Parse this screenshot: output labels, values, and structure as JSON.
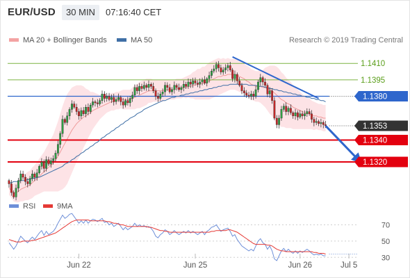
{
  "header": {
    "symbol": "EUR/USD",
    "timeframe": "30 MIN",
    "time": "07:16:40 CET"
  },
  "credit": "Research © 2019 Trading Central",
  "colors": {
    "up": "#2f9e44",
    "down": "#c62828",
    "bb_fill": "#fde3e6",
    "ma20": "#ef9a9a",
    "ma50": "#3f6fa6",
    "support": "#e3000f",
    "resistance": "#7cb342",
    "pivot": "#2e66cc",
    "price_tag": "#333333",
    "rsi": "#6e8fd8",
    "rsi_ma": "#e53935"
  },
  "chart_data": [
    {
      "type": "candlestick",
      "title": "EUR/USD 30 MIN",
      "legend": [
        {
          "name": "MA 20 + Bollinger Bands",
          "color": "#ef9a9a"
        },
        {
          "name": "MA 50",
          "color": "#3f6fa6"
        }
      ],
      "legend_position": "top",
      "x_ticks": [
        "Jun 22",
        "Jun 25",
        "Jun 26",
        "Jul 5"
      ],
      "ylim": [
        1.128,
        1.144
      ],
      "levels": [
        {
          "label": "1.1410",
          "value": 1.141,
          "kind": "resistance"
        },
        {
          "label": "1.1395",
          "value": 1.1395,
          "kind": "resistance"
        },
        {
          "label": "1.1380",
          "value": 1.138,
          "kind": "pivot"
        },
        {
          "label": "1.1353",
          "value": 1.1353,
          "kind": "last_price"
        },
        {
          "label": "1.1340",
          "value": 1.134,
          "kind": "support"
        },
        {
          "label": "1.1320",
          "value": 1.132,
          "kind": "support"
        }
      ],
      "close": [
        1.13,
        1.1292,
        1.1288,
        1.1296,
        1.1303,
        1.1309,
        1.1306,
        1.1302,
        1.13,
        1.1305,
        1.1309,
        1.1306,
        1.131,
        1.1316,
        1.132,
        1.1314,
        1.1322,
        1.1318,
        1.1321,
        1.1323,
        1.1328,
        1.1336,
        1.1346,
        1.1359,
        1.1356,
        1.1362,
        1.1368,
        1.1373,
        1.137,
        1.1366,
        1.1362,
        1.1367,
        1.1364,
        1.137,
        1.1366,
        1.1372,
        1.1375,
        1.1374,
        1.1373,
        1.1376,
        1.1382,
        1.1378,
        1.138,
        1.1377,
        1.1379,
        1.1375,
        1.1377,
        1.1379,
        1.1375,
        1.1372,
        1.1376,
        1.1374,
        1.1378,
        1.1381,
        1.1388,
        1.1385,
        1.1389,
        1.1387,
        1.139,
        1.1388,
        1.1391,
        1.1389,
        1.1385,
        1.138,
        1.1378,
        1.1382,
        1.1384,
        1.139,
        1.1388,
        1.1384,
        1.1386,
        1.139,
        1.1388,
        1.1386,
        1.1388,
        1.1391,
        1.1389,
        1.1393,
        1.1391,
        1.1394,
        1.1392,
        1.1391,
        1.1393,
        1.1395,
        1.1392,
        1.1396,
        1.1399,
        1.1403,
        1.1405,
        1.1409,
        1.1406,
        1.1402,
        1.1404,
        1.1406,
        1.1408,
        1.1404,
        1.1396,
        1.14,
        1.1394,
        1.139,
        1.1385,
        1.1383,
        1.1381,
        1.138,
        1.1382,
        1.138,
        1.1386,
        1.1393,
        1.1397,
        1.1393,
        1.139,
        1.1382,
        1.1385,
        1.1376,
        1.136,
        1.1354,
        1.136,
        1.1368,
        1.1371,
        1.1366,
        1.1369,
        1.1365,
        1.1362,
        1.1365,
        1.1361,
        1.1364,
        1.1362,
        1.1364,
        1.1366,
        1.1364,
        1.1359,
        1.1356,
        1.1357,
        1.1355,
        1.1356,
        1.1354,
        1.1353
      ],
      "ma20": [
        1.1296,
        1.1294,
        1.1292,
        1.1292,
        1.1293,
        1.1295,
        1.1296,
        1.1297,
        1.1298,
        1.1299,
        1.1301,
        1.1303,
        1.1305,
        1.1307,
        1.1309,
        1.1311,
        1.1313,
        1.1315,
        1.1317,
        1.1319,
        1.1322,
        1.1325,
        1.1329,
        1.1333,
        1.1337,
        1.1341,
        1.1345,
        1.1349,
        1.1352,
        1.1355,
        1.1357,
        1.1359,
        1.1361,
        1.1362,
        1.1364,
        1.1365,
        1.1367,
        1.1368,
        1.1369,
        1.137,
        1.1371,
        1.1372,
        1.1373,
        1.1374,
        1.1375,
        1.1375,
        1.1376,
        1.1376,
        1.1377,
        1.1377,
        1.1377,
        1.1377,
        1.1377,
        1.1378,
        1.1379,
        1.138,
        1.1381,
        1.1382,
        1.1383,
        1.1384,
        1.1385,
        1.1385,
        1.1385,
        1.1385,
        1.1385,
        1.1385,
        1.1385,
        1.1386,
        1.1386,
        1.1386,
        1.1386,
        1.1386,
        1.1387,
        1.1387,
        1.1387,
        1.1388,
        1.1388,
        1.1389,
        1.1389,
        1.139,
        1.139,
        1.1391,
        1.1391,
        1.1392,
        1.1392,
        1.1393,
        1.1394,
        1.1395,
        1.1396,
        1.1397,
        1.1398,
        1.1398,
        1.1399,
        1.1399,
        1.14,
        1.14,
        1.14,
        1.14,
        1.1399,
        1.1398,
        1.1397,
        1.1396,
        1.1394,
        1.1393,
        1.1391,
        1.139,
        1.1389,
        1.1389,
        1.1389,
        1.1388,
        1.1388,
        1.1387,
        1.1386,
        1.1385,
        1.1383,
        1.1381,
        1.1379,
        1.1377,
        1.1376,
        1.1374,
        1.1373,
        1.1372,
        1.137,
        1.1369,
        1.1368,
        1.1367,
        1.1366,
        1.1365,
        1.1364,
        1.1364,
        1.1363,
        1.1362,
        1.1362,
        1.1361,
        1.1361,
        1.136,
        1.136
      ],
      "bb_width": [
        0.0006,
        0.0007,
        0.0008,
        0.0009,
        0.001,
        0.0011,
        0.0012,
        0.0012,
        0.0013,
        0.0013,
        0.0014,
        0.0014,
        0.0015,
        0.0016,
        0.0017,
        0.0018,
        0.002,
        0.0022,
        0.0024,
        0.0026,
        0.0029,
        0.0032,
        0.0035,
        0.0038,
        0.004,
        0.0041,
        0.004,
        0.0039,
        0.0037,
        0.0035,
        0.0033,
        0.0031,
        0.0028,
        0.0025,
        0.0022,
        0.0019,
        0.0017,
        0.0015,
        0.0013,
        0.0011,
        0.001,
        0.0009,
        0.0008,
        0.0008,
        0.0008,
        0.0008,
        0.0008,
        0.0008,
        0.0008,
        0.0009,
        0.0009,
        0.0009,
        0.0009,
        0.001,
        0.0011,
        0.0011,
        0.0012,
        0.0012,
        0.0012,
        0.0012,
        0.0011,
        0.0011,
        0.001,
        0.001,
        0.001,
        0.001,
        0.001,
        0.0009,
        0.0009,
        0.0009,
        0.0009,
        0.0009,
        0.0009,
        0.0009,
        0.0009,
        0.0009,
        0.001,
        0.001,
        0.0011,
        0.0012,
        0.0013,
        0.0014,
        0.0014,
        0.0015,
        0.0015,
        0.0016,
        0.0017,
        0.0017,
        0.0017,
        0.0017,
        0.0017,
        0.0016,
        0.0016,
        0.0015,
        0.0015,
        0.0014,
        0.0014,
        0.0014,
        0.0014,
        0.0014,
        0.0014,
        0.0014,
        0.0014,
        0.0014,
        0.0014,
        0.0014,
        0.0014,
        0.0014,
        0.0015,
        0.0016,
        0.0018,
        0.002,
        0.0022,
        0.0023,
        0.0025,
        0.0026,
        0.0026,
        0.0025,
        0.0024,
        0.0023,
        0.0022,
        0.0021,
        0.002,
        0.0019,
        0.0018,
        0.0017,
        0.0016,
        0.0015,
        0.0014,
        0.0014,
        0.0013,
        0.0013,
        0.0012,
        0.0012,
        0.0012,
        0.0012,
        0.0012
      ],
      "ma50": [
        1.1301,
        1.1301,
        1.1302,
        1.1302,
        1.1302,
        1.1303,
        1.1303,
        1.1303,
        1.1304,
        1.1304,
        1.1305,
        1.1305,
        1.1306,
        1.1306,
        1.1307,
        1.1308,
        1.1309,
        1.131,
        1.1311,
        1.1312,
        1.1313,
        1.1314,
        1.1315,
        1.1316,
        1.1318,
        1.1319,
        1.132,
        1.1322,
        1.1323,
        1.1325,
        1.1326,
        1.1328,
        1.1329,
        1.1331,
        1.1332,
        1.1334,
        1.1335,
        1.1337,
        1.1338,
        1.134,
        1.1342,
        1.1343,
        1.1345,
        1.1346,
        1.1348,
        1.1349,
        1.1351,
        1.1352,
        1.1354,
        1.1355,
        1.1357,
        1.1358,
        1.136,
        1.1361,
        1.1362,
        1.1364,
        1.1365,
        1.1366,
        1.1368,
        1.1369,
        1.137,
        1.1371,
        1.1372,
        1.1373,
        1.1374,
        1.1375,
        1.1376,
        1.1376,
        1.1377,
        1.1378,
        1.1379,
        1.1379,
        1.138,
        1.138,
        1.1381,
        1.1381,
        1.1382,
        1.1382,
        1.1383,
        1.1383,
        1.1384,
        1.1384,
        1.1385,
        1.1385,
        1.1386,
        1.1386,
        1.1387,
        1.1387,
        1.1388,
        1.1388,
        1.1389,
        1.1389,
        1.139,
        1.139,
        1.139,
        1.1391,
        1.1391,
        1.1391,
        1.1391,
        1.1391,
        1.1391,
        1.1391,
        1.1391,
        1.139,
        1.139,
        1.139,
        1.139,
        1.1389,
        1.1389,
        1.1389,
        1.1388,
        1.1388,
        1.1387,
        1.1387,
        1.1386,
        1.1386,
        1.1385,
        1.1385,
        1.1384,
        1.1384,
        1.1383,
        1.1383,
        1.1382,
        1.1382,
        1.1381,
        1.1381,
        1.138,
        1.138,
        1.1379,
        1.1379,
        1.1378,
        1.1378,
        1.1377,
        1.1377,
        1.1376,
        1.1376,
        1.1375
      ],
      "trendline": {
        "from_bar": 96,
        "from_value": 1.1416,
        "to_bar": 133,
        "to_value": 1.1378
      },
      "forecast_arrow": {
        "from_bar": 136,
        "from_value": 1.1353,
        "to_bar": 150,
        "to_value": 1.1322
      }
    },
    {
      "type": "line",
      "title": "RSI",
      "legend": [
        {
          "name": "RSI",
          "color": "#6e8fd8"
        },
        {
          "name": "9MA",
          "color": "#e53935"
        }
      ],
      "ylim": [
        20,
        85
      ],
      "y_ticks": [
        70,
        50,
        30
      ],
      "rsi": [
        48,
        44,
        40,
        44,
        50,
        56,
        53,
        50,
        48,
        52,
        55,
        52,
        56,
        60,
        63,
        57,
        62,
        58,
        60,
        62,
        66,
        72,
        77,
        82,
        78,
        80,
        83,
        84,
        80,
        76,
        72,
        75,
        72,
        76,
        72,
        75,
        77,
        76,
        74,
        76,
        78,
        73,
        74,
        70,
        72,
        68,
        70,
        72,
        68,
        64,
        67,
        64,
        66,
        68,
        72,
        68,
        70,
        68,
        69,
        67,
        68,
        66,
        62,
        56,
        54,
        58,
        60,
        64,
        62,
        58,
        60,
        63,
        60,
        58,
        60,
        62,
        60,
        63,
        60,
        62,
        60,
        58,
        60,
        62,
        58,
        62,
        64,
        67,
        68,
        70,
        66,
        62,
        64,
        65,
        66,
        62,
        56,
        58,
        52,
        48,
        44,
        42,
        40,
        38,
        40,
        38,
        44,
        50,
        53,
        48,
        46,
        40,
        44,
        38,
        28,
        26,
        32,
        38,
        41,
        37,
        40,
        37,
        35,
        38,
        35,
        38,
        36,
        38,
        40,
        38,
        35,
        33,
        34,
        33,
        34,
        32,
        32
      ],
      "rsi_ma": [
        52,
        51,
        50,
        49,
        49,
        49,
        50,
        50,
        50,
        50,
        51,
        51,
        52,
        53,
        54,
        55,
        56,
        57,
        58,
        59,
        60,
        62,
        64,
        66,
        68,
        70,
        72,
        74,
        75,
        76,
        76,
        76,
        76,
        76,
        76,
        75,
        75,
        75,
        75,
        75,
        75,
        75,
        74,
        74,
        73,
        72,
        72,
        71,
        70,
        70,
        69,
        68,
        68,
        68,
        68,
        68,
        68,
        68,
        68,
        68,
        67,
        67,
        66,
        65,
        64,
        63,
        63,
        62,
        62,
        61,
        61,
        61,
        61,
        61,
        61,
        61,
        61,
        61,
        61,
        61,
        61,
        61,
        61,
        61,
        61,
        61,
        61,
        62,
        62,
        63,
        63,
        63,
        63,
        63,
        64,
        64,
        63,
        62,
        61,
        59,
        57,
        55,
        53,
        51,
        49,
        47,
        46,
        46,
        46,
        46,
        46,
        45,
        45,
        44,
        42,
        40,
        39,
        38,
        38,
        37,
        37,
        37,
        37,
        37,
        37,
        37,
        37,
        37,
        37,
        37,
        37,
        36,
        36,
        35,
        35,
        35,
        34
      ],
      "ma_dotted_level": 34
    }
  ]
}
